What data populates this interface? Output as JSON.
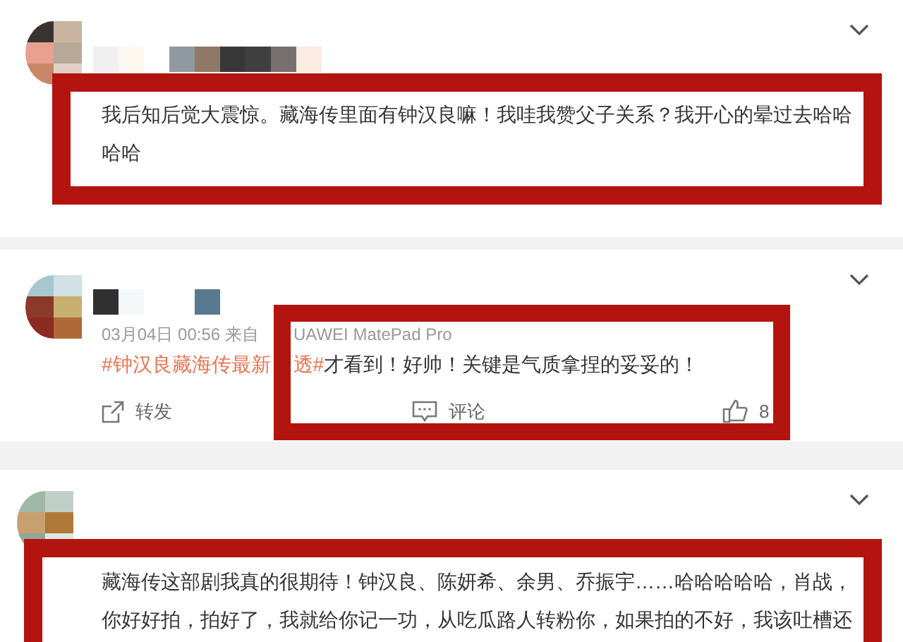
{
  "posts": [
    {
      "highlighted": true,
      "lines": [
        "我后知后觉大震惊。藏海传里面有钟汉良嘛！我哇我赞父子关系？我开心的晕过去哈哈",
        "哈哈"
      ]
    },
    {
      "highlighted": true,
      "meta": {
        "time": "03月04日 00:56 来自",
        "device": "UAWEI MatePad Pro"
      },
      "tag_start": "#钟汉良藏海传最新",
      "tag_end": "透#",
      "lines": [
        "才看到！好帅！关键是气质拿捏的妥妥的！"
      ],
      "actions": {
        "repost": "转发",
        "comment": "评论",
        "likes": "8"
      }
    },
    {
      "highlighted": true,
      "lines": [
        "藏海传这部剧我真的很期待！钟汉良、陈妍希、余男、乔振宇……哈哈哈哈哈，肖战，",
        "你好好拍，拍好了，我就给你记一功，从吃瓜路人转粉你，如果拍的不好，我该吐槽还"
      ]
    }
  ]
}
